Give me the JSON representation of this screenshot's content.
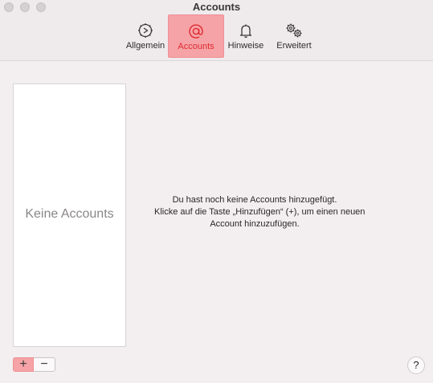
{
  "window": {
    "title": "Accounts"
  },
  "toolbar": {
    "tabs": [
      {
        "label": "Allgemein",
        "icon": "gear-timer-icon",
        "selected": false
      },
      {
        "label": "Accounts",
        "icon": "at-sign-icon",
        "selected": true
      },
      {
        "label": "Hinweise",
        "icon": "bell-icon",
        "selected": false
      },
      {
        "label": "Erweitert",
        "icon": "gears-icon",
        "selected": false
      }
    ]
  },
  "accounts_list": {
    "empty_label": "Keine Accounts"
  },
  "info": {
    "line1": "Du hast noch keine Accounts hinzugefügt.",
    "line2": "Klicke auf die Taste „Hinzufügen“ (+), um einen neuen",
    "line3": "Account hinzuzufügen."
  },
  "buttons": {
    "add_label": "+",
    "remove_label": "−",
    "help_label": "?"
  },
  "colors": {
    "accent": "#e02b32",
    "highlight": "#f5a3a6"
  }
}
